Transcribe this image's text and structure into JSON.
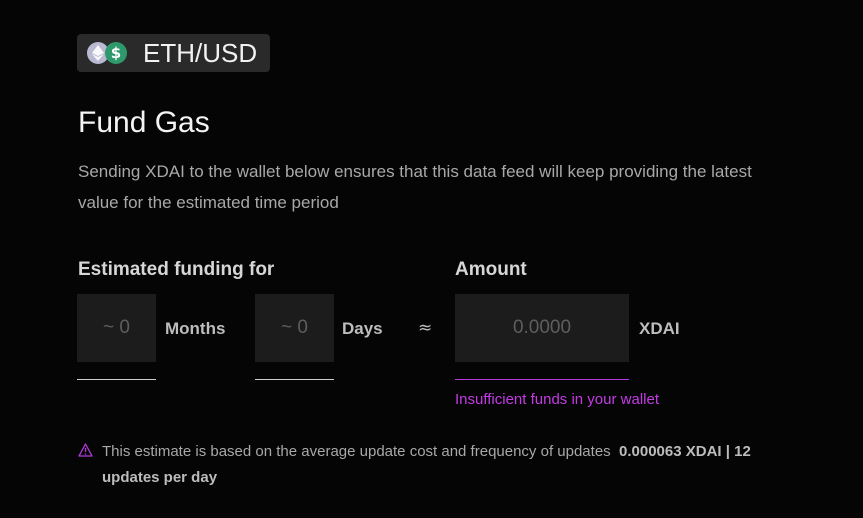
{
  "pair": {
    "label": "ETH/USD",
    "icons": [
      "ethereum-icon",
      "dollar-icon"
    ],
    "usd_symbol": "$",
    "colors": {
      "badge_bg": "#2a2a2a",
      "eth": "#b9bad2",
      "usd": "#2e9a6c"
    }
  },
  "title": "Fund Gas",
  "description": "Sending XDAI to the wallet below ensures that this data feed will keep providing the latest value for the estimated time period",
  "funding": {
    "label": "Estimated funding for",
    "months": {
      "placeholder": "~ 0",
      "unit": "Months"
    },
    "days": {
      "placeholder": "~ 0",
      "unit": "Days"
    },
    "approx_symbol": "≈"
  },
  "amount": {
    "label": "Amount",
    "placeholder": "0.0000",
    "unit": "XDAI",
    "error": "Insufficient funds in your wallet",
    "error_color": "#c43be6"
  },
  "note": {
    "icon": "warning-icon",
    "text": "This estimate is based on the average update cost and frequency of updates",
    "value": "0.000063 XDAI | 12 updates per day"
  }
}
